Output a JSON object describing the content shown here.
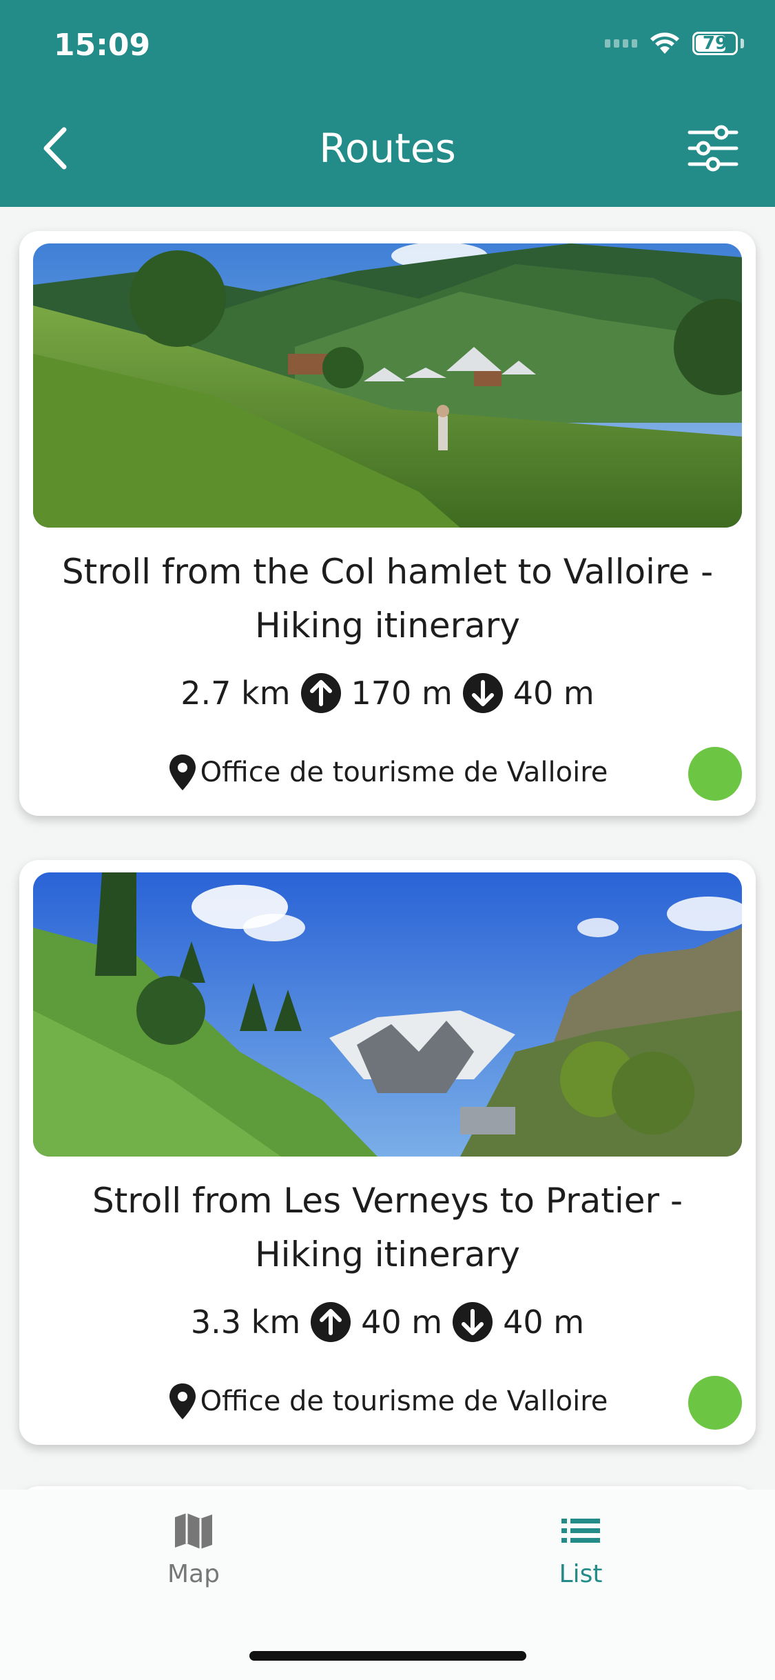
{
  "status_bar": {
    "time": "15:09",
    "battery": "79",
    "battery_level": 0.79
  },
  "header": {
    "title": "Routes",
    "back_icon": "chevron-left-icon",
    "filter_icon": "sliders-icon"
  },
  "colors": {
    "header_bg": "#238c88",
    "accent": "#238c88",
    "difficulty_easy": "#6cc644",
    "nav_inactive": "#777777"
  },
  "routes": [
    {
      "title": "Stroll from the Col hamlet to Valloire - Hiking itinerary",
      "distance": "2.7 km",
      "ascent": "170 m",
      "descent": "40 m",
      "location": "Office de tourisme de Valloire",
      "difficulty_color": "#6cc644"
    },
    {
      "title": "Stroll from Les Verneys to Pratier - Hiking itinerary",
      "distance": "3.3 km",
      "ascent": "40 m",
      "descent": "40 m",
      "location": "Office de tourisme de Valloire",
      "difficulty_color": "#6cc644"
    }
  ],
  "bottom_nav": {
    "items": [
      {
        "label": "Map",
        "icon": "map-icon",
        "active": false
      },
      {
        "label": "List",
        "icon": "list-icon",
        "active": true
      }
    ]
  }
}
